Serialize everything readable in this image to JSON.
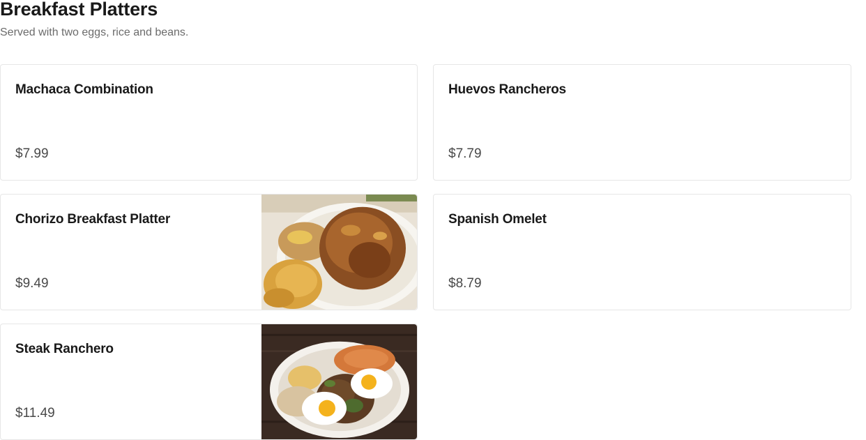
{
  "section": {
    "title": "Breakfast Platters",
    "subtitle": "Served with two eggs, rice and beans."
  },
  "items": [
    {
      "name": "Machaca Combination",
      "price": "$7.99"
    },
    {
      "name": "Huevos Rancheros",
      "price": "$7.79"
    },
    {
      "name": "Chorizo Breakfast Platter",
      "price": "$9.49"
    },
    {
      "name": "Spanish Omelet",
      "price": "$8.79"
    },
    {
      "name": "Steak Ranchero",
      "price": "$11.49"
    }
  ],
  "colors": {
    "title": "#191919",
    "subtitle": "#6b6b6b",
    "price": "#494949",
    "card_border": "#e6e6e6"
  }
}
